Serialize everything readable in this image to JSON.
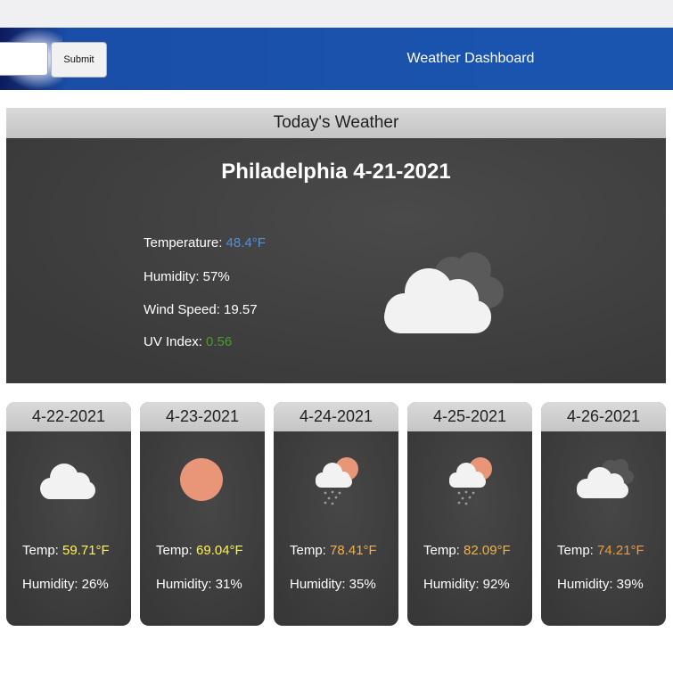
{
  "header": {
    "search_value": "",
    "submit_label": "Submit",
    "title": "Weather Dashboard"
  },
  "today": {
    "heading": "Today's Weather",
    "city_date": "Philadelphia 4-21-2021",
    "temperature_label": "Temperature: ",
    "temperature_value": "48.4°F",
    "humidity": "Humidity: 57%",
    "wind": "Wind Speed: 19.57",
    "uv_label": "UV Index: ",
    "uv_value": "0.56",
    "icon": "cloudy-icon"
  },
  "forecast": [
    {
      "date": "4-22-2021",
      "temp_label": "Temp: ",
      "temp": "59.71°F",
      "humidity": "Humidity: 26%",
      "icon": "cloud-icon",
      "temp_color": "#fff44f"
    },
    {
      "date": "4-23-2021",
      "temp_label": "Temp: ",
      "temp": "69.04°F",
      "humidity": "Humidity: 31%",
      "icon": "sun-icon",
      "temp_color": "#fff44f"
    },
    {
      "date": "4-24-2021",
      "temp_label": "Temp: ",
      "temp": "78.41°F",
      "humidity": "Humidity: 35%",
      "icon": "sun-rain-icon",
      "temp_color": "#f1b14a"
    },
    {
      "date": "4-25-2021",
      "temp_label": "Temp: ",
      "temp": "82.09°F",
      "humidity": "Humidity: 92%",
      "icon": "sun-rain-icon",
      "temp_color": "#f1b14a"
    },
    {
      "date": "4-26-2021",
      "temp_label": "Temp: ",
      "temp": "74.21°F",
      "humidity": "Humidity: 39%",
      "icon": "cloudy-icon",
      "temp_color": "#ee9a3c"
    }
  ],
  "colors": {
    "header_blue": "#1a56b0",
    "panel_dark": "#3d3d3d",
    "temp_blue": "#4f8fdd",
    "uv_green": "#4c9a2a",
    "sun": "#e89677"
  }
}
